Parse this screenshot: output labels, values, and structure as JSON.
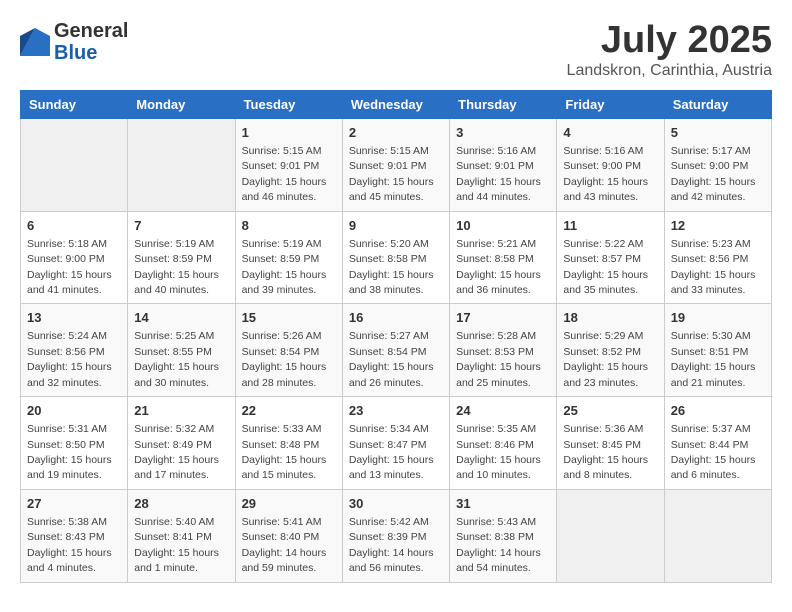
{
  "header": {
    "logo_general": "General",
    "logo_blue": "Blue",
    "month": "July 2025",
    "location": "Landskron, Carinthia, Austria"
  },
  "days_of_week": [
    "Sunday",
    "Monday",
    "Tuesday",
    "Wednesday",
    "Thursday",
    "Friday",
    "Saturday"
  ],
  "weeks": [
    [
      {
        "day": "",
        "info": ""
      },
      {
        "day": "",
        "info": ""
      },
      {
        "day": "1",
        "info": "Sunrise: 5:15 AM\nSunset: 9:01 PM\nDaylight: 15 hours and 46 minutes."
      },
      {
        "day": "2",
        "info": "Sunrise: 5:15 AM\nSunset: 9:01 PM\nDaylight: 15 hours and 45 minutes."
      },
      {
        "day": "3",
        "info": "Sunrise: 5:16 AM\nSunset: 9:01 PM\nDaylight: 15 hours and 44 minutes."
      },
      {
        "day": "4",
        "info": "Sunrise: 5:16 AM\nSunset: 9:00 PM\nDaylight: 15 hours and 43 minutes."
      },
      {
        "day": "5",
        "info": "Sunrise: 5:17 AM\nSunset: 9:00 PM\nDaylight: 15 hours and 42 minutes."
      }
    ],
    [
      {
        "day": "6",
        "info": "Sunrise: 5:18 AM\nSunset: 9:00 PM\nDaylight: 15 hours and 41 minutes."
      },
      {
        "day": "7",
        "info": "Sunrise: 5:19 AM\nSunset: 8:59 PM\nDaylight: 15 hours and 40 minutes."
      },
      {
        "day": "8",
        "info": "Sunrise: 5:19 AM\nSunset: 8:59 PM\nDaylight: 15 hours and 39 minutes."
      },
      {
        "day": "9",
        "info": "Sunrise: 5:20 AM\nSunset: 8:58 PM\nDaylight: 15 hours and 38 minutes."
      },
      {
        "day": "10",
        "info": "Sunrise: 5:21 AM\nSunset: 8:58 PM\nDaylight: 15 hours and 36 minutes."
      },
      {
        "day": "11",
        "info": "Sunrise: 5:22 AM\nSunset: 8:57 PM\nDaylight: 15 hours and 35 minutes."
      },
      {
        "day": "12",
        "info": "Sunrise: 5:23 AM\nSunset: 8:56 PM\nDaylight: 15 hours and 33 minutes."
      }
    ],
    [
      {
        "day": "13",
        "info": "Sunrise: 5:24 AM\nSunset: 8:56 PM\nDaylight: 15 hours and 32 minutes."
      },
      {
        "day": "14",
        "info": "Sunrise: 5:25 AM\nSunset: 8:55 PM\nDaylight: 15 hours and 30 minutes."
      },
      {
        "day": "15",
        "info": "Sunrise: 5:26 AM\nSunset: 8:54 PM\nDaylight: 15 hours and 28 minutes."
      },
      {
        "day": "16",
        "info": "Sunrise: 5:27 AM\nSunset: 8:54 PM\nDaylight: 15 hours and 26 minutes."
      },
      {
        "day": "17",
        "info": "Sunrise: 5:28 AM\nSunset: 8:53 PM\nDaylight: 15 hours and 25 minutes."
      },
      {
        "day": "18",
        "info": "Sunrise: 5:29 AM\nSunset: 8:52 PM\nDaylight: 15 hours and 23 minutes."
      },
      {
        "day": "19",
        "info": "Sunrise: 5:30 AM\nSunset: 8:51 PM\nDaylight: 15 hours and 21 minutes."
      }
    ],
    [
      {
        "day": "20",
        "info": "Sunrise: 5:31 AM\nSunset: 8:50 PM\nDaylight: 15 hours and 19 minutes."
      },
      {
        "day": "21",
        "info": "Sunrise: 5:32 AM\nSunset: 8:49 PM\nDaylight: 15 hours and 17 minutes."
      },
      {
        "day": "22",
        "info": "Sunrise: 5:33 AM\nSunset: 8:48 PM\nDaylight: 15 hours and 15 minutes."
      },
      {
        "day": "23",
        "info": "Sunrise: 5:34 AM\nSunset: 8:47 PM\nDaylight: 15 hours and 13 minutes."
      },
      {
        "day": "24",
        "info": "Sunrise: 5:35 AM\nSunset: 8:46 PM\nDaylight: 15 hours and 10 minutes."
      },
      {
        "day": "25",
        "info": "Sunrise: 5:36 AM\nSunset: 8:45 PM\nDaylight: 15 hours and 8 minutes."
      },
      {
        "day": "26",
        "info": "Sunrise: 5:37 AM\nSunset: 8:44 PM\nDaylight: 15 hours and 6 minutes."
      }
    ],
    [
      {
        "day": "27",
        "info": "Sunrise: 5:38 AM\nSunset: 8:43 PM\nDaylight: 15 hours and 4 minutes."
      },
      {
        "day": "28",
        "info": "Sunrise: 5:40 AM\nSunset: 8:41 PM\nDaylight: 15 hours and 1 minute."
      },
      {
        "day": "29",
        "info": "Sunrise: 5:41 AM\nSunset: 8:40 PM\nDaylight: 14 hours and 59 minutes."
      },
      {
        "day": "30",
        "info": "Sunrise: 5:42 AM\nSunset: 8:39 PM\nDaylight: 14 hours and 56 minutes."
      },
      {
        "day": "31",
        "info": "Sunrise: 5:43 AM\nSunset: 8:38 PM\nDaylight: 14 hours and 54 minutes."
      },
      {
        "day": "",
        "info": ""
      },
      {
        "day": "",
        "info": ""
      }
    ]
  ]
}
